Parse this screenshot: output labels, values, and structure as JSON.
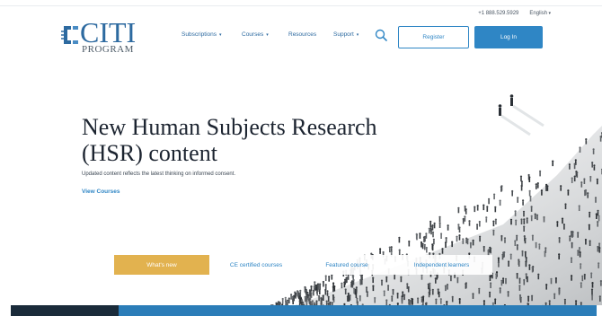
{
  "utility": {
    "phone": "+1 888.529.5929",
    "language": "English"
  },
  "logo": {
    "name_top": "CITI",
    "name_bottom": "PROGRAM"
  },
  "nav": {
    "items": [
      {
        "label": "Subscriptions",
        "has_caret": true
      },
      {
        "label": "Courses",
        "has_caret": true
      },
      {
        "label": "Resources",
        "has_caret": false
      },
      {
        "label": "Support",
        "has_caret": true
      }
    ],
    "search_icon": "search-icon"
  },
  "buttons": {
    "register": "Register",
    "login": "Log In"
  },
  "hero": {
    "title": "New Human Subjects Research (HSR) content",
    "subtitle": "Updated content reflects the latest thinking on informed consent.",
    "link": "View Courses"
  },
  "tabs": [
    {
      "label": "What's new",
      "active": true
    },
    {
      "label": "CE certified courses",
      "active": false
    },
    {
      "label": "Featured course",
      "active": false
    },
    {
      "label": "Independent learners",
      "active": false
    }
  ],
  "colors": {
    "brand_blue": "#2f86c5",
    "accent_gold": "#e2b24f",
    "footer_blue": "#2b7db8"
  }
}
